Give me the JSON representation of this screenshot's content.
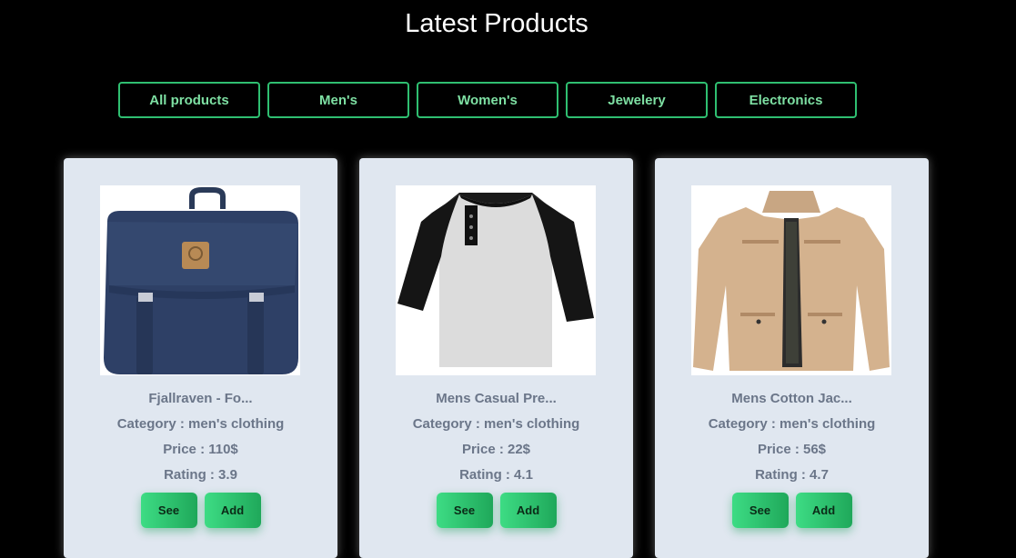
{
  "page": {
    "title": "Latest Products"
  },
  "filters": [
    "All products",
    "Men's",
    "Women's",
    "Jewelery",
    "Electronics"
  ],
  "products": [
    {
      "title": "Fjallraven - Fo...",
      "category": "Category : men's clothing",
      "price": "Price : 110$",
      "rating": "Rating : 3.9",
      "see_label": "See",
      "add_label": "Add",
      "image": "backpack-image"
    },
    {
      "title": "Mens Casual Pre...",
      "category": "Category : men's clothing",
      "price": "Price : 22$",
      "rating": "Rating : 4.1",
      "see_label": "See",
      "add_label": "Add",
      "image": "tshirt-image"
    },
    {
      "title": "Mens Cotton Jac...",
      "category": "Category : men's clothing",
      "price": "Price : 56$",
      "rating": "Rating : 4.7",
      "see_label": "See",
      "add_label": "Add",
      "image": "jacket-image"
    }
  ],
  "colors": {
    "accent": "#2fbf71",
    "filter_text": "#7ee0a3",
    "card_bg": "#e0e7f0",
    "card_text": "#6b7689"
  }
}
